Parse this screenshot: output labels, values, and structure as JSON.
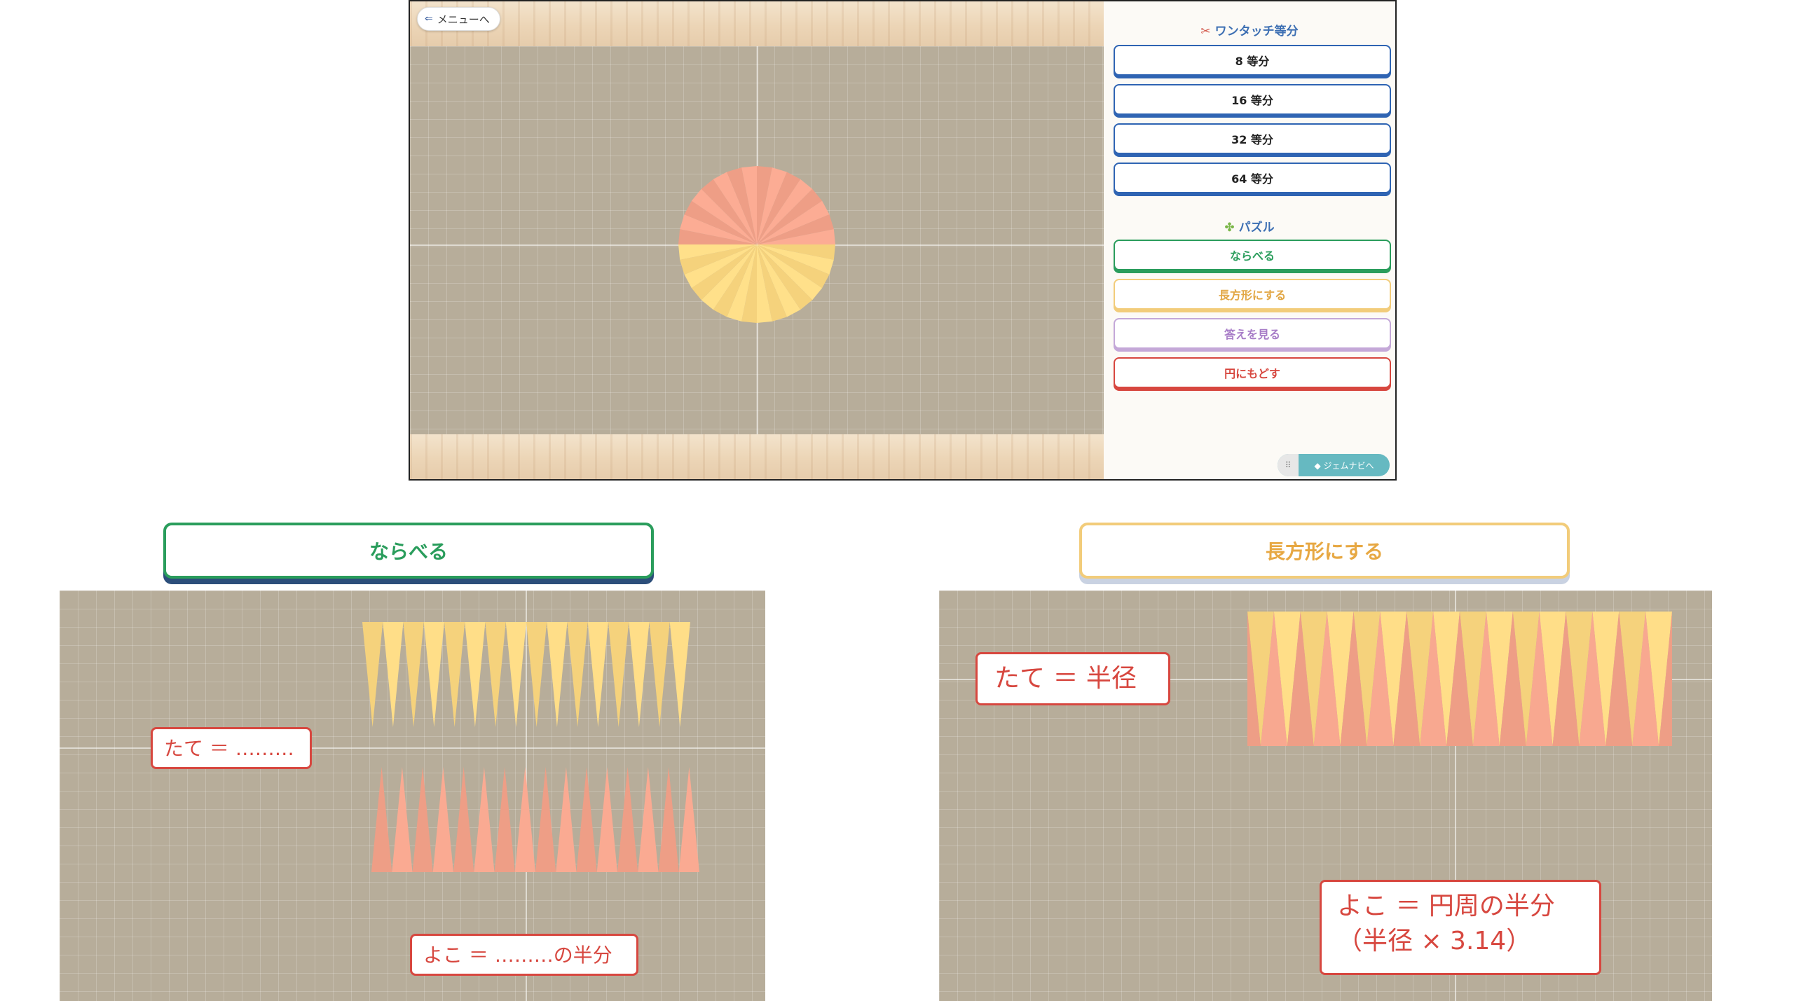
{
  "app": {
    "menu_label": "メニューへ",
    "section_divide": {
      "title": "ワンタッチ等分",
      "buttons": [
        "8 等分",
        "16 等分",
        "32 等分",
        "64 等分"
      ]
    },
    "section_puzzle": {
      "title": "パズル",
      "buttons": [
        "ならべる",
        "長方形にする",
        "答えを見る",
        "円にもどす"
      ]
    },
    "gemnavi_label": "ジェムナビへ",
    "circle": {
      "divisions": 32,
      "top_color": "#ee9e86",
      "bottom_color": "#f5d27c"
    }
  },
  "panel_left": {
    "header": "ならべる",
    "label_tate": "たて ＝ ………",
    "label_yoko": "よこ ＝ ………の半分",
    "top_row_color": "#f5d27c",
    "bottom_row_color": "#ee9e86",
    "wedges_per_row": 16
  },
  "panel_right": {
    "header": "長方形にする",
    "label_tate": "たて ＝ 半径",
    "label_yoko": "よこ ＝ 円周の半分\n（半径 × 3.14）",
    "wedges_per_row": 16
  }
}
